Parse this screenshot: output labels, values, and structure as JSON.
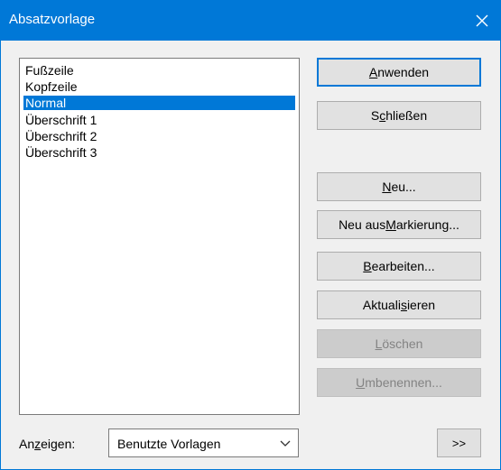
{
  "window": {
    "title": "Absatzvorlage"
  },
  "styles_list": {
    "items": [
      {
        "label": "Fußzeile",
        "selected": false
      },
      {
        "label": "Kopfzeile",
        "selected": false
      },
      {
        "label": "Normal",
        "selected": true
      },
      {
        "label": "Überschrift 1",
        "selected": false
      },
      {
        "label": "Überschrift 2",
        "selected": false
      },
      {
        "label": "Überschrift 3",
        "selected": false
      }
    ]
  },
  "buttons": {
    "apply": {
      "pre": "",
      "key": "A",
      "post": "nwenden",
      "enabled": true
    },
    "close": {
      "pre": "S",
      "key": "c",
      "post": "hließen",
      "enabled": true
    },
    "new": {
      "pre": "",
      "key": "N",
      "post": "eu...",
      "enabled": true
    },
    "new_from_selection": {
      "pre": "Neu aus ",
      "key": "M",
      "post": "arkierung...",
      "enabled": true
    },
    "edit": {
      "pre": "",
      "key": "B",
      "post": "earbeiten...",
      "enabled": true
    },
    "update": {
      "pre": "Aktuali",
      "key": "s",
      "post": "ieren",
      "enabled": true
    },
    "delete": {
      "pre": "",
      "key": "L",
      "post": "öschen",
      "enabled": false
    },
    "rename": {
      "pre": "",
      "key": "U",
      "post": "mbenennen...",
      "enabled": false
    },
    "more": {
      "label": ">>"
    }
  },
  "show": {
    "label_pre": "An",
    "label_key": "z",
    "label_post": "eigen:",
    "selected_value": "Benutzte Vorlagen"
  },
  "icons": {
    "close": "close-icon",
    "dropdown": "chevron-down-icon"
  },
  "colors": {
    "accent": "#0078d7",
    "dialog_bg": "#f0f0f0",
    "button_bg": "#e1e1e1",
    "disabled_text": "#838383"
  }
}
